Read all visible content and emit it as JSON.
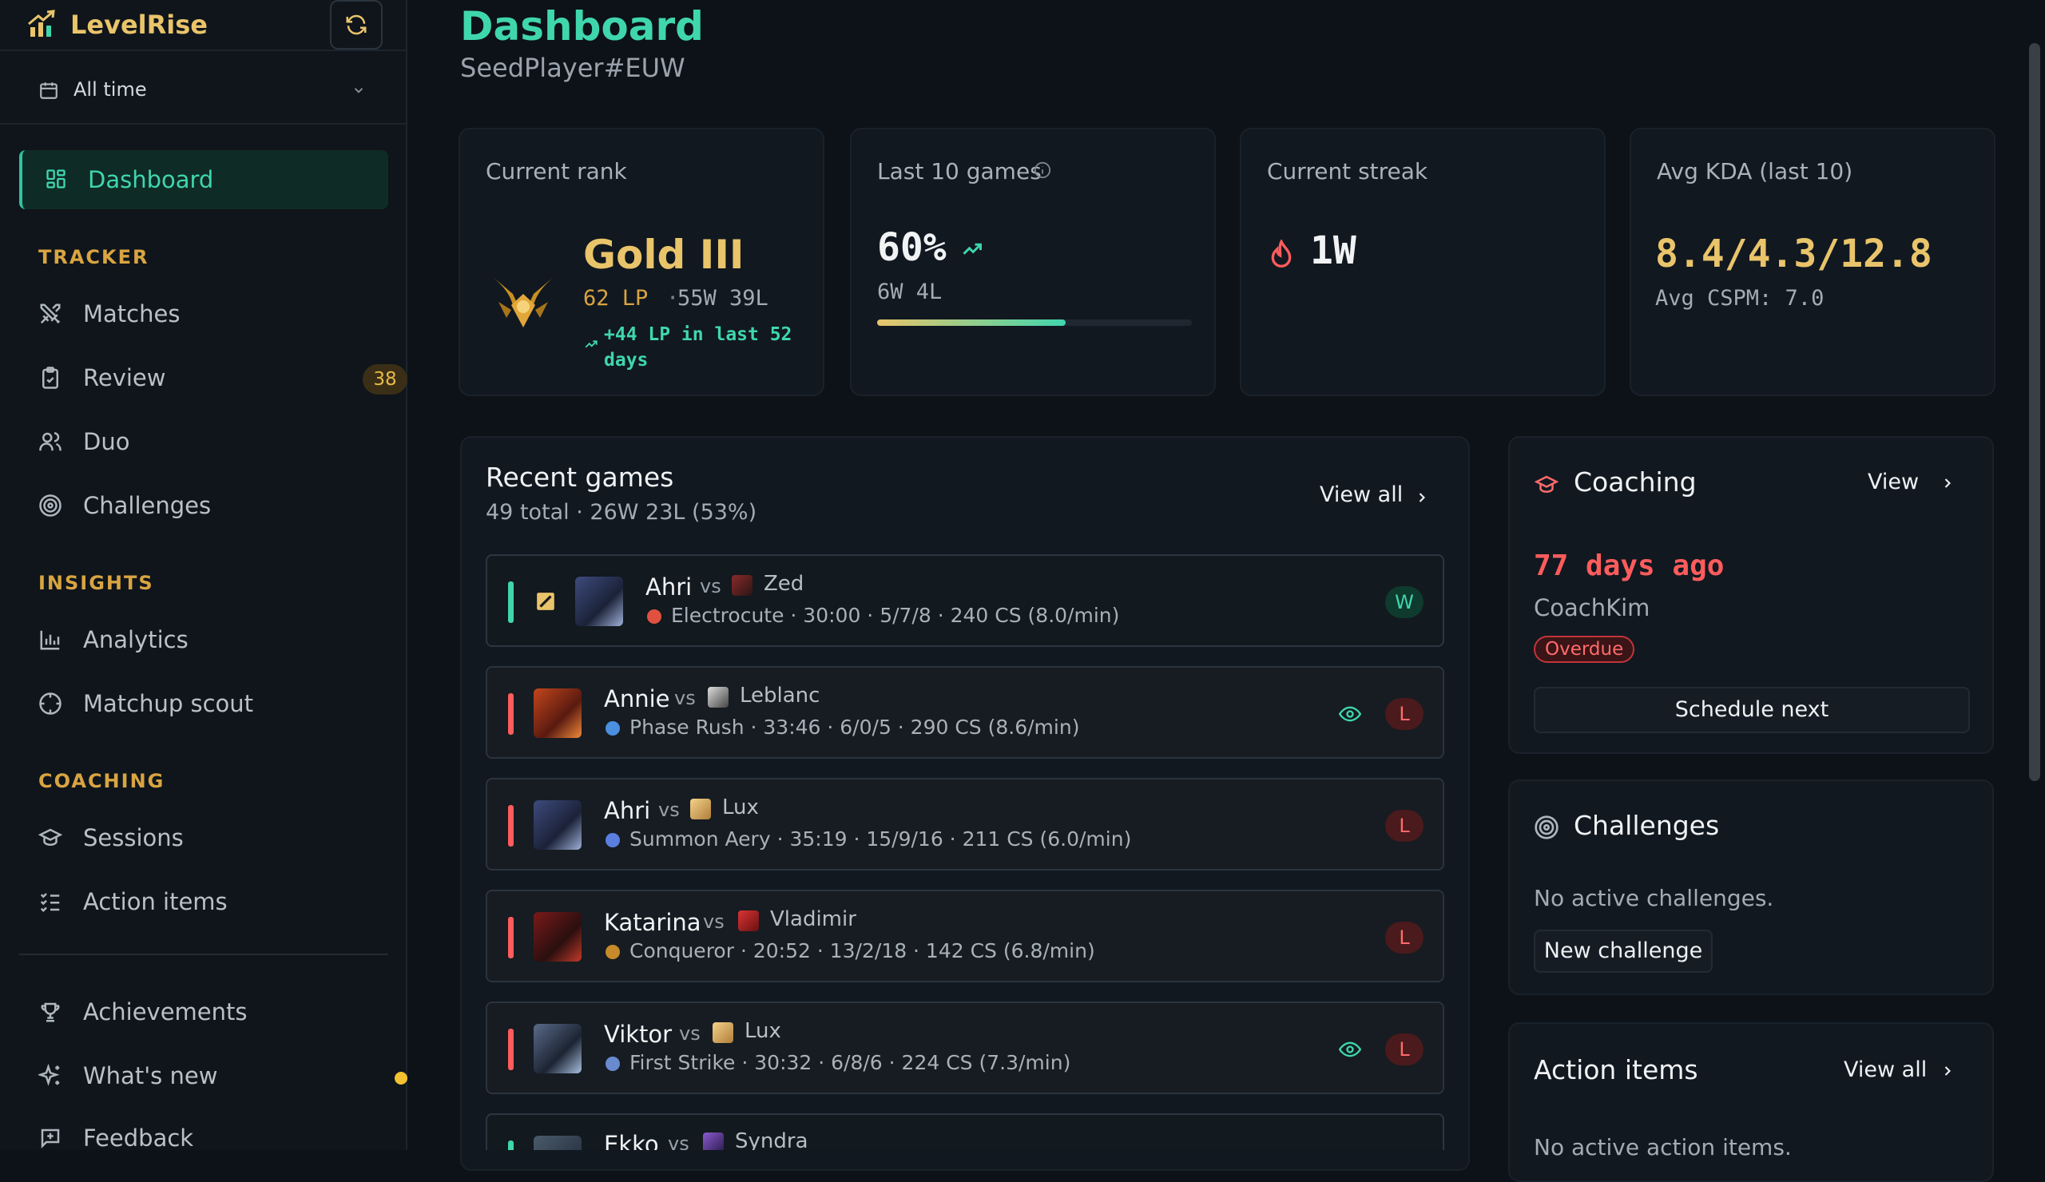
{
  "app": {
    "name": "LevelRise"
  },
  "sidebar": {
    "period": "All time",
    "active": "Dashboard",
    "sections": {
      "tracker": "TRACKER",
      "insights": "INSIGHTS",
      "coaching": "COACHING"
    },
    "items": {
      "matches": "Matches",
      "review": "Review",
      "review_badge": "38",
      "duo": "Duo",
      "challenges": "Challenges",
      "analytics": "Analytics",
      "matchup": "Matchup scout",
      "sessions": "Sessions",
      "action_items": "Action items",
      "achievements": "Achievements",
      "whats_new": "What's new",
      "feedback": "Feedback"
    }
  },
  "header": {
    "title": "Dashboard",
    "subtitle": "SeedPlayer#EUW"
  },
  "stats": {
    "rank": {
      "label": "Current rank",
      "tier": "Gold III",
      "lp": "62 LP",
      "record": "55W 39L",
      "trend_line1": "+44 LP in last 52",
      "trend_line2": "days"
    },
    "last10": {
      "label": "Last 10 games",
      "pct": "60%",
      "record": "6W 4L",
      "winrate": 0.6
    },
    "streak": {
      "label": "Current streak",
      "value": "1W"
    },
    "kda": {
      "label": "Avg KDA (last 10)",
      "value": "8.4/4.3/12.8",
      "cspm": "Avg CSPM: 7.0"
    }
  },
  "recent": {
    "title": "Recent games",
    "summary": "49 total · 26W 23L (53%)",
    "view_all": "View all",
    "games": [
      {
        "champ": "Ahri",
        "vs": "vs",
        "opp": "Zed",
        "line": "Electrocute · 30:00 · 5/7/8 · 240 CS (8.0/min)",
        "result": "W"
      },
      {
        "champ": "Annie",
        "vs": "vs",
        "opp": "Leblanc",
        "line": "Phase Rush · 33:46 · 6/0/5 · 290 CS (8.6/min)",
        "result": "L"
      },
      {
        "champ": "Ahri",
        "vs": "vs",
        "opp": "Lux",
        "line": "Summon Aery · 35:19 · 15/9/16 · 211 CS (6.0/min)",
        "result": "L"
      },
      {
        "champ": "Katarina",
        "vs": "vs",
        "opp": "Vladimir",
        "line": "Conqueror · 20:52 · 13/2/18 · 142 CS (6.8/min)",
        "result": "L"
      },
      {
        "champ": "Viktor",
        "vs": "vs",
        "opp": "Lux",
        "line": "First Strike · 30:32 · 6/8/6 · 224 CS (7.3/min)",
        "result": "L"
      },
      {
        "champ": "Ekko",
        "vs": "vs",
        "opp": "Syndra"
      }
    ]
  },
  "coaching": {
    "title": "Coaching",
    "view": "View",
    "ago": "77 days ago",
    "coach": "CoachKim",
    "status": "Overdue",
    "schedule": "Schedule next"
  },
  "challenges": {
    "title": "Challenges",
    "empty": "No active challenges.",
    "new": "New challenge"
  },
  "action_items": {
    "title": "Action items",
    "view_all": "View all",
    "empty": "No active action items."
  },
  "colors": {
    "accent": "#3fd6ae",
    "gold": "#e9c46a",
    "loss": "#ff5c5c",
    "bg": "#0d1218"
  }
}
